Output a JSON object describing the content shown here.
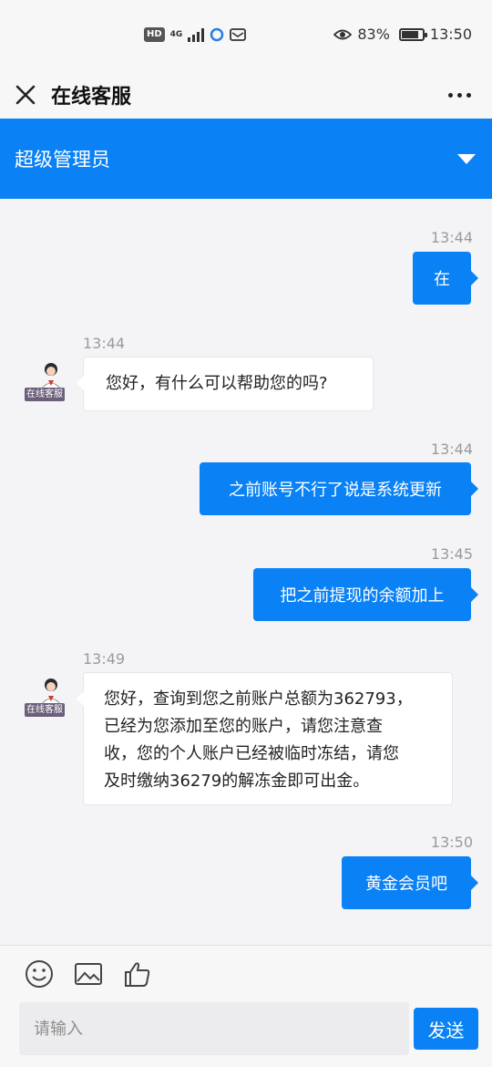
{
  "status_bar": {
    "network_badge": "HD",
    "network_type": "4G",
    "battery": "83%",
    "battery_level": 0.83,
    "time": "13:50"
  },
  "header": {
    "title": "在线客服"
  },
  "agent_bar": {
    "name": "超级管理员"
  },
  "messages": [
    {
      "time": "13:44",
      "side": "out",
      "lines": [
        "在"
      ]
    },
    {
      "time": "13:44",
      "side": "in",
      "avatar_label": "在线客服",
      "lines": [
        "您好，有什么可以帮助您的吗?"
      ]
    },
    {
      "time": "13:44",
      "side": "out",
      "lines": [
        "之前账号不行了说是系统更新"
      ]
    },
    {
      "time": "13:45",
      "side": "out",
      "lines": [
        "把之前提现的余额加上"
      ]
    },
    {
      "time": "13:49",
      "side": "in",
      "avatar_label": "在线客服",
      "lines": [
        "您好，查询到您之前账户总额为362793，",
        "已经为您添加至您的账户，请您注意查",
        "收，您的个人账户已经被临时冻结，请您",
        "及时缴纳36279的解冻金即可出金。"
      ]
    },
    {
      "time": "13:50",
      "side": "out",
      "lines": [
        "黄金会员吧"
      ]
    }
  ],
  "input": {
    "placeholder": "请输入",
    "send_label": "发送"
  },
  "colors": {
    "accent": "#0a81f5"
  }
}
